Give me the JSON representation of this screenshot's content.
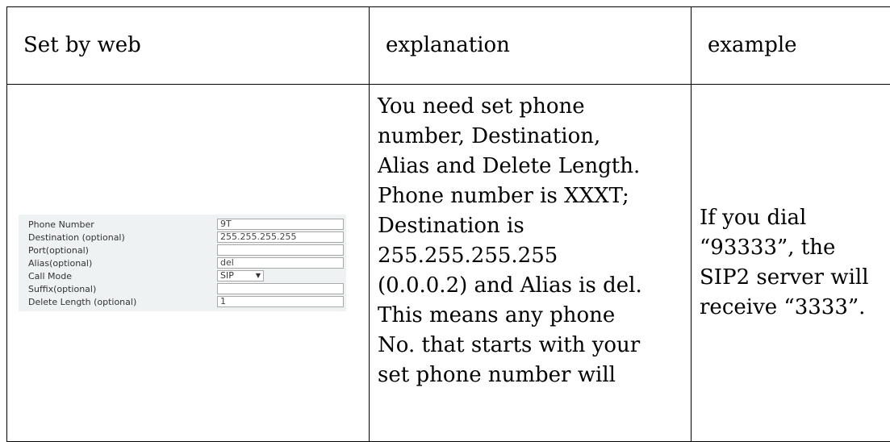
{
  "table": {
    "headers": [
      "Set by web",
      "explanation",
      "example"
    ],
    "explanation_lines": [
      "You need set phone",
      "number, Destination,",
      "Alias and Delete Length.",
      "Phone number is XXXT;",
      "Destination is",
      "255.255.255.255",
      "(0.0.0.2) and Alias is del.",
      "This means any phone",
      "No. that starts with your",
      "set phone number will"
    ],
    "example_lines": [
      "If you dial",
      "“93333”, the",
      "SIP2 server will",
      "receive “3333”."
    ]
  },
  "form": {
    "phone_number_label": "Phone Number",
    "phone_number_value": "9T",
    "destination_label": "Destination (optional)",
    "destination_value": "255.255.255.255",
    "port_label": "Port(optional)",
    "port_value": "",
    "alias_label": "Alias(optional)",
    "alias_value": "del",
    "call_mode_label": "Call Mode",
    "call_mode_value": "SIP",
    "suffix_label": "Suffix(optional)",
    "suffix_value": "",
    "delete_length_label": "Delete Length (optional)",
    "delete_length_value": "1"
  }
}
